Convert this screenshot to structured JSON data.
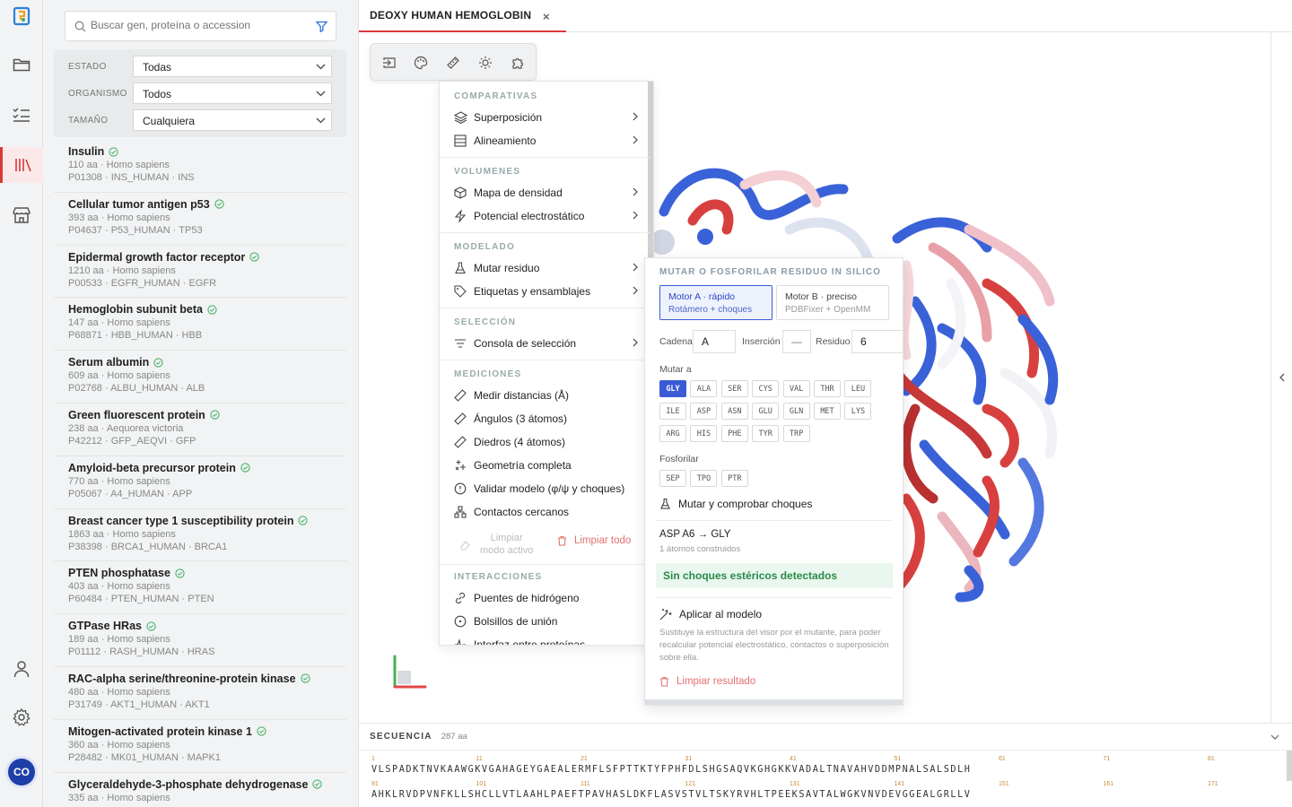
{
  "tab": {
    "title": "DEOXY HUMAN HEMOGLOBIN",
    "close": "×"
  },
  "user": {
    "initials": "CO"
  },
  "search": {
    "placeholder": "Buscar gen, proteína o accession"
  },
  "filters": [
    {
      "label": "ESTADO",
      "value": "Todas"
    },
    {
      "label": "ORGANISMO",
      "value": "Todos"
    },
    {
      "label": "TAMAÑO",
      "value": "Cualquiera"
    }
  ],
  "proteins": [
    {
      "name": "Insulin",
      "meta1": "110 aa · Homo sapiens",
      "meta2": "P01308 · INS_HUMAN · INS"
    },
    {
      "name": "Cellular tumor antigen p53",
      "meta1": "393 aa · Homo sapiens",
      "meta2": "P04637 · P53_HUMAN · TP53"
    },
    {
      "name": "Epidermal growth factor receptor",
      "meta1": "1210 aa · Homo sapiens",
      "meta2": "P00533 · EGFR_HUMAN · EGFR"
    },
    {
      "name": "Hemoglobin subunit beta",
      "meta1": "147 aa · Homo sapiens",
      "meta2": "P68871 · HBB_HUMAN · HBB"
    },
    {
      "name": "Serum albumin",
      "meta1": "609 aa · Homo sapiens",
      "meta2": "P02768 · ALBU_HUMAN · ALB"
    },
    {
      "name": "Green fluorescent protein",
      "meta1": "238 aa · Aequorea victoria",
      "meta2": "P42212 · GFP_AEQVI · GFP"
    },
    {
      "name": "Amyloid-beta precursor protein",
      "meta1": "770 aa · Homo sapiens",
      "meta2": "P05067 · A4_HUMAN · APP"
    },
    {
      "name": "Breast cancer type 1 susceptibility protein",
      "meta1": "1863 aa · Homo sapiens",
      "meta2": "P38398 · BRCA1_HUMAN · BRCA1"
    },
    {
      "name": "PTEN phosphatase",
      "meta1": "403 aa · Homo sapiens",
      "meta2": "P60484 · PTEN_HUMAN · PTEN"
    },
    {
      "name": "GTPase HRas",
      "meta1": "189 aa · Homo sapiens",
      "meta2": "P01112 · RASH_HUMAN · HRAS"
    },
    {
      "name": "RAC-alpha serine/threonine-protein kinase",
      "meta1": "480 aa · Homo sapiens",
      "meta2": "P31749 · AKT1_HUMAN · AKT1"
    },
    {
      "name": "Mitogen-activated protein kinase 1",
      "meta1": "360 aa · Homo sapiens",
      "meta2": "P28482 · MK01_HUMAN · MAPK1"
    },
    {
      "name": "Glyceraldehyde-3-phosphate dehydrogenase",
      "meta1": "335 aa · Homo sapiens",
      "meta2": ""
    }
  ],
  "menu": {
    "comparativas": "COMPARATIVAS",
    "superposicion": "Superposición",
    "alineamiento": "Alineamiento",
    "volumenes": "VOLUMENES",
    "densidad": "Mapa de densidad",
    "electrostatico": "Potencial electrostático",
    "modelado": "MODELADO",
    "mutar": "Mutar residuo",
    "etiquetas": "Etiquetas y ensamblajes",
    "seleccion": "SELECCIÓN",
    "consola": "Consola de selección",
    "mediciones": "MEDICIONES",
    "distancias": "Medir distancias (Å)",
    "angulos": "Ángulos (3 átomos)",
    "diedros": "Diedros (4 átomos)",
    "geometria": "Geometría completa",
    "validar": "Validar modelo (φ/ψ y choques)",
    "contactos": "Contactos cercanos",
    "limpiar_modo_1": "Limpiar",
    "limpiar_modo_2": "modo activo",
    "limpiar_todo": "Limpiar todo",
    "interacciones": "INTERACCIONES",
    "puentes": "Puentes de hidrógeno",
    "bolsillos": "Bolsillos de unión",
    "interfaz": "Interfaz entre proteínas"
  },
  "mutpanel": {
    "title": "MUTAR O FOSFORILAR RESIDUO IN SILICO",
    "engineA_title": "Motor A · rápido",
    "engineA_sub": "Rotámero + choques",
    "engineB_title": "Motor B · preciso",
    "engineB_sub": "PDBFixer + OpenMM",
    "cadena_label": "Cadena",
    "cadena_value": "A",
    "insercion_label": "Inserción",
    "insercion_value": "—",
    "residuo_label": "Residuo",
    "residuo_value": "6",
    "mutar_a": "Mutar a",
    "aminoacids": [
      "GLY",
      "ALA",
      "SER",
      "CYS",
      "VAL",
      "THR",
      "LEU",
      "ILE",
      "ASP",
      "ASN",
      "GLU",
      "GLN",
      "MET",
      "LYS",
      "ARG",
      "HIS",
      "PHE",
      "TYR",
      "TRP"
    ],
    "selected": "GLY",
    "fosforilar": "Fosforilar",
    "phospho": [
      "SEP",
      "TPO",
      "PTR"
    ],
    "check_btn": "Mutar y comprobar choques",
    "result_title": "ASP A6 → GLY",
    "result_sub": "1 átomos construidos",
    "ok_msg": "Sin choques estéricos detectados",
    "apply_btn": "Aplicar al modelo",
    "apply_desc": "Sustituye la estructura del visor por el mutante, para poder recalcular potencial electrostático, contactos o superposición sobre ella.",
    "clear_btn": "Limpiar resultado"
  },
  "sequence": {
    "title": "SECUENCIA",
    "length": "287 aa",
    "line1": "VLSPADKTNVKAAWGKVGAHAGEYGAEALERMFLSFPTTKTYFPHFDLSHGSAQVKGHGKKVADALTNAVAHVDDMPNALSALSDLH",
    "line2": "AHKLRVDPVNFKLLSHCLLVTLAAHLPAEFTPAVHASLDKFLASVSTVLTSKYRVHLTPEEKSAVTALWGKVNVDEVGGEALGRLLV",
    "nums1": [
      "1",
      "11",
      "21",
      "31",
      "41",
      "51",
      "61",
      "71",
      "81"
    ],
    "nums2": [
      "91",
      "101",
      "111",
      "121",
      "131",
      "141",
      "151",
      "161",
      "171"
    ]
  }
}
